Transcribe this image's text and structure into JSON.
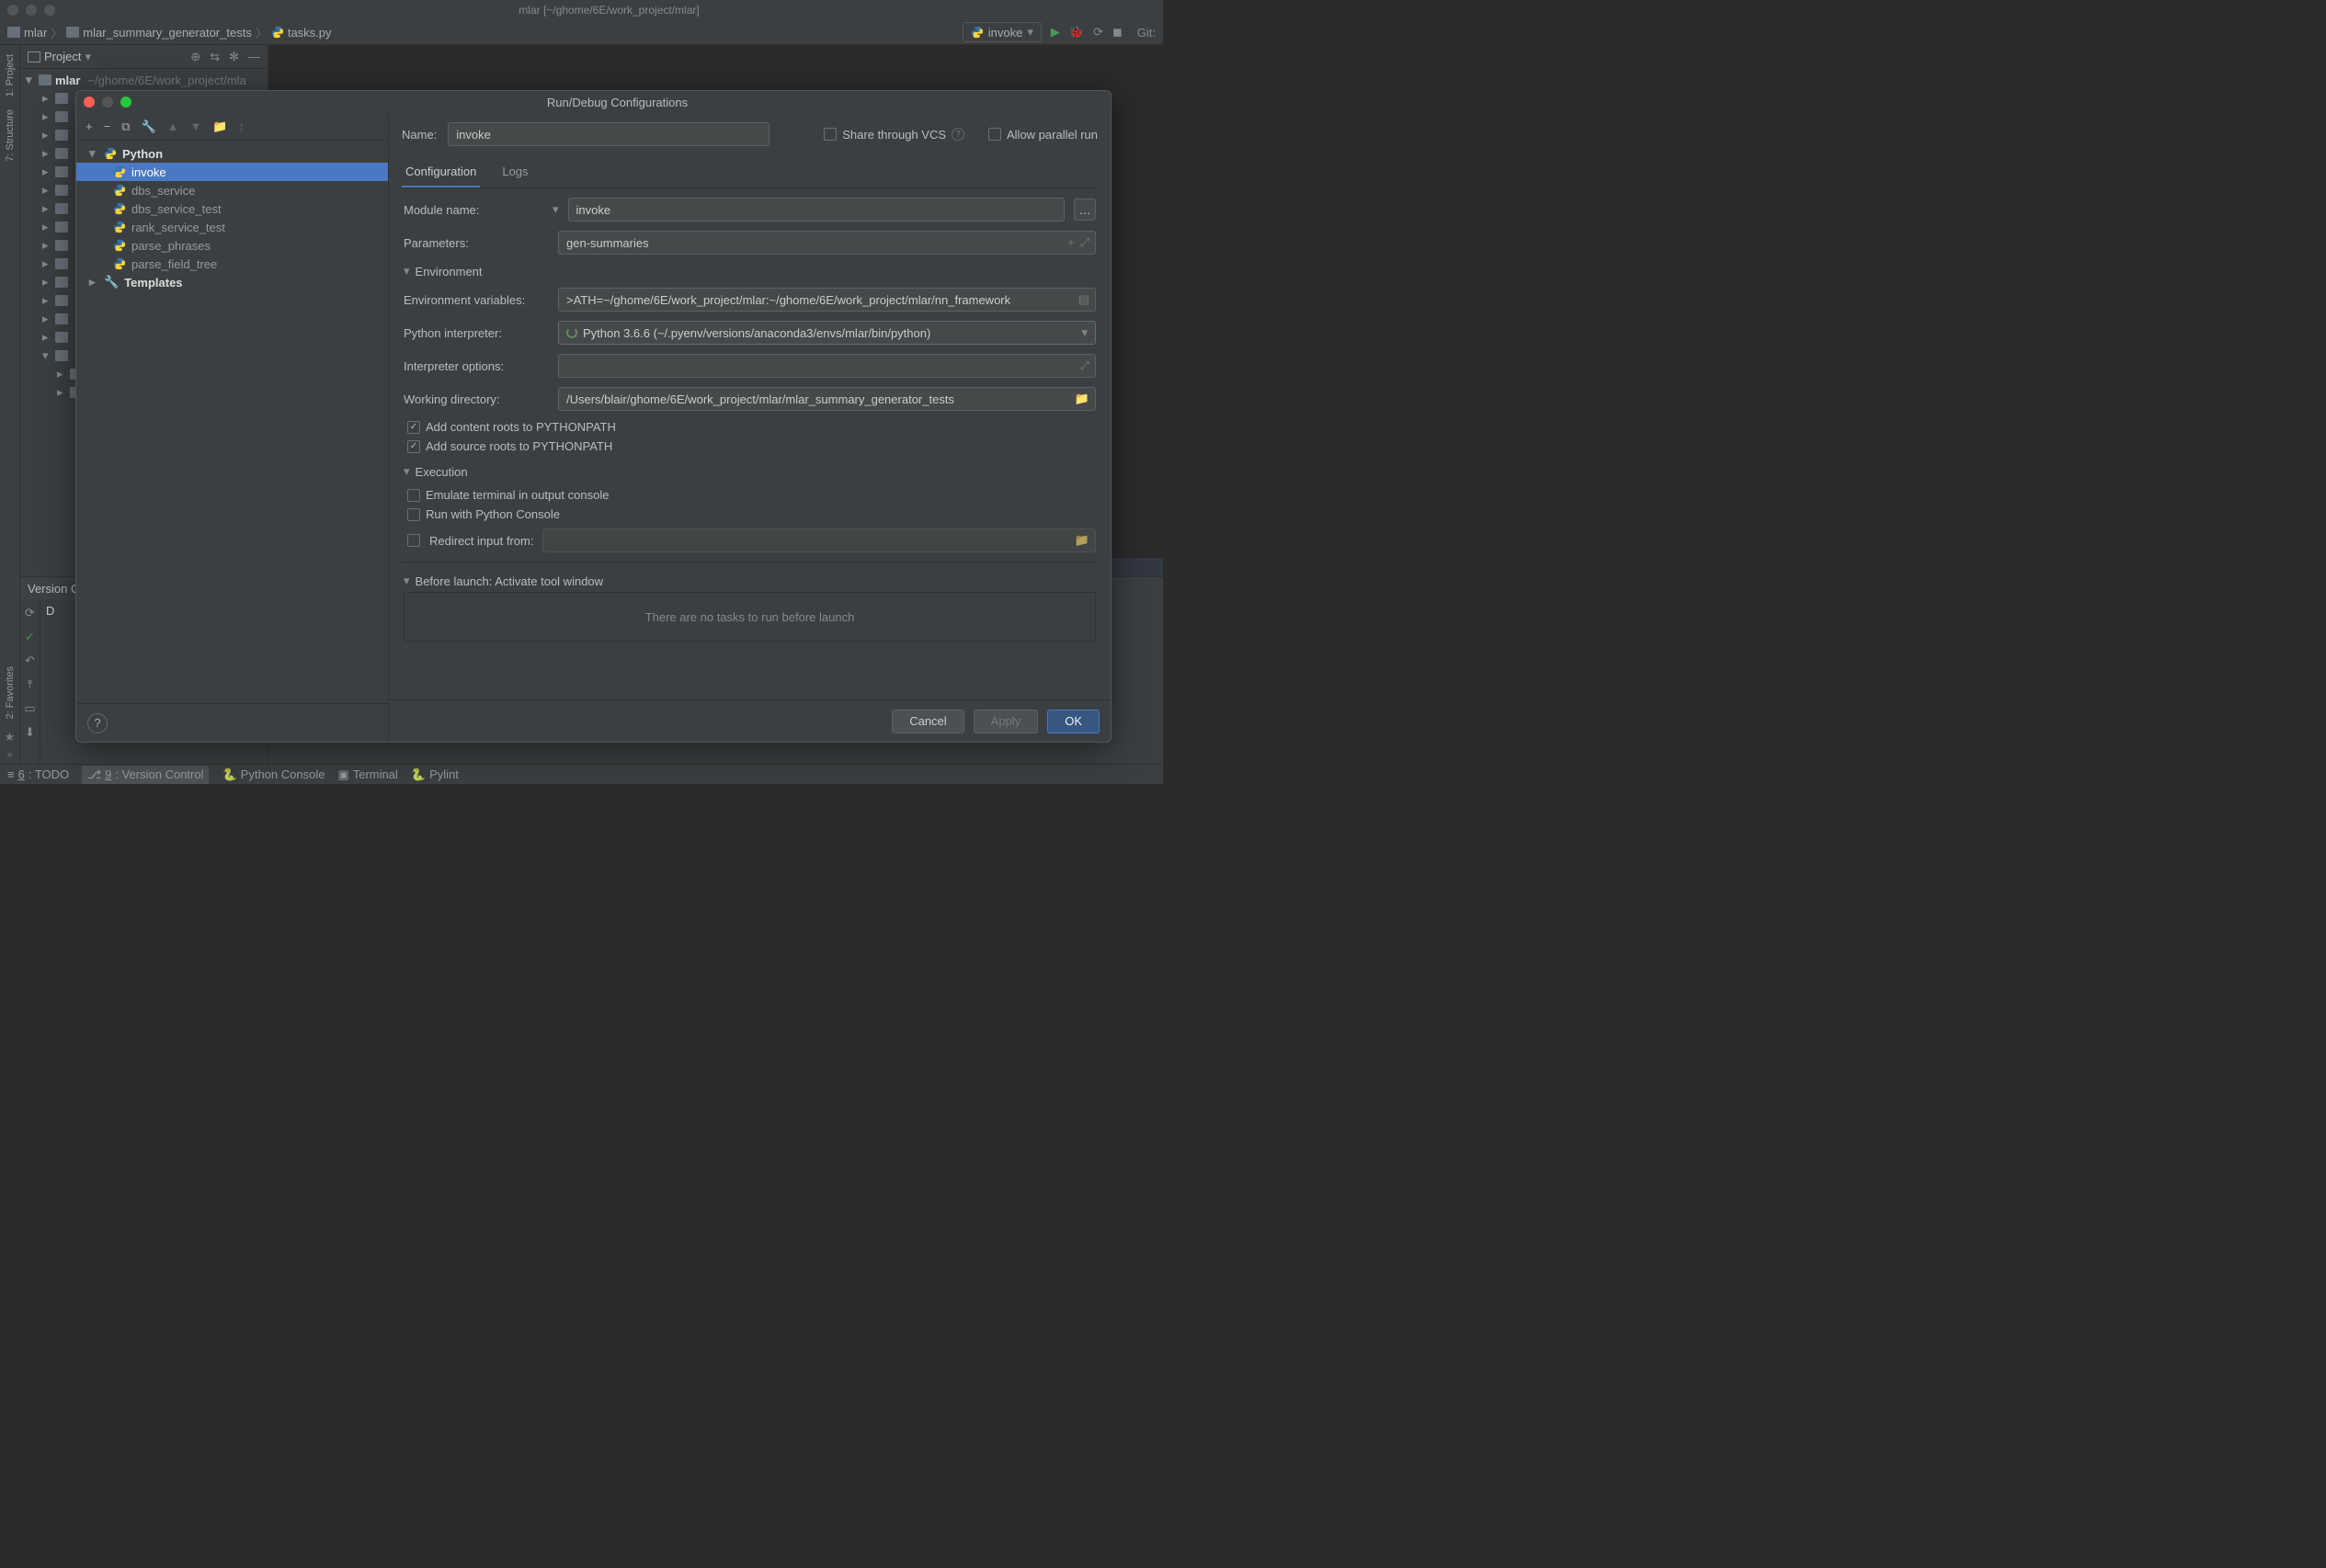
{
  "titlebar": {
    "title": "mlar [~/ghome/6E/work_project/mlar]"
  },
  "breadcrumbs": {
    "items": [
      "mlar",
      "mlar_summary_generator_tests",
      "tasks.py"
    ]
  },
  "run_combo": {
    "label": "invoke"
  },
  "navbar_right": {
    "git": "Git:"
  },
  "project_panel": {
    "title": "Project",
    "root": {
      "name": "mlar",
      "path": "~/ghome/6E/work_project/mla"
    }
  },
  "vc_panel": {
    "title": "Version C",
    "tab": "D"
  },
  "left_tabs": {
    "project": "1: Project",
    "structure": "7: Structure",
    "favorites": "2: Favorites"
  },
  "bottombar": {
    "todo": "6: TODO",
    "vcs": "9: Version Control",
    "console": "Python Console",
    "terminal": "Terminal",
    "pylint": "Pylint"
  },
  "dialog": {
    "title": "Run/Debug Configurations",
    "toolbar": {
      "add": "+",
      "remove": "−",
      "copy": "⧉",
      "wrench": "🔧",
      "up": "▲",
      "down": "▼"
    },
    "tree": {
      "groups": [
        {
          "name": "Python",
          "expanded": true,
          "items": [
            "invoke",
            "dbs_service",
            "dbs_service_test",
            "rank_service_test",
            "parse_phrases",
            "parse_field_tree"
          ],
          "selected": 0
        },
        {
          "name": "Templates",
          "expanded": false
        }
      ]
    },
    "name_label": "Name:",
    "name_value": "invoke",
    "share_label": "Share through VCS",
    "allow_label": "Allow parallel run",
    "tabs": {
      "config": "Configuration",
      "logs": "Logs"
    },
    "fields": {
      "module_label": "Module name:",
      "module_value": "invoke",
      "params_label": "Parameters:",
      "params_value": "gen-summaries",
      "env_section": "Environment",
      "envvars_label": "Environment variables:",
      "envvars_value": ">ATH=~/ghome/6E/work_project/mlar:~/ghome/6E/work_project/mlar/nn_framework",
      "interp_label": "Python interpreter:",
      "interp_value": "Python 3.6.6 (~/.pyenv/versions/anaconda3/envs/mlar/bin/python)",
      "interp_opts_label": "Interpreter options:",
      "interp_opts_value": "",
      "workdir_label": "Working directory:",
      "workdir_value": "/Users/blair/ghome/6E/work_project/mlar/mlar_summary_generator_tests",
      "content_roots": "Add content roots to PYTHONPATH",
      "source_roots": "Add source roots to PYTHONPATH",
      "exec_section": "Execution",
      "emulate": "Emulate terminal in output console",
      "pyconsole": "Run with Python Console",
      "redirect": "Redirect input from:",
      "before_label": "Before launch: Activate tool window",
      "before_empty": "There are no tasks to run before launch"
    },
    "buttons": {
      "cancel": "Cancel",
      "apply": "Apply",
      "ok": "OK"
    }
  }
}
